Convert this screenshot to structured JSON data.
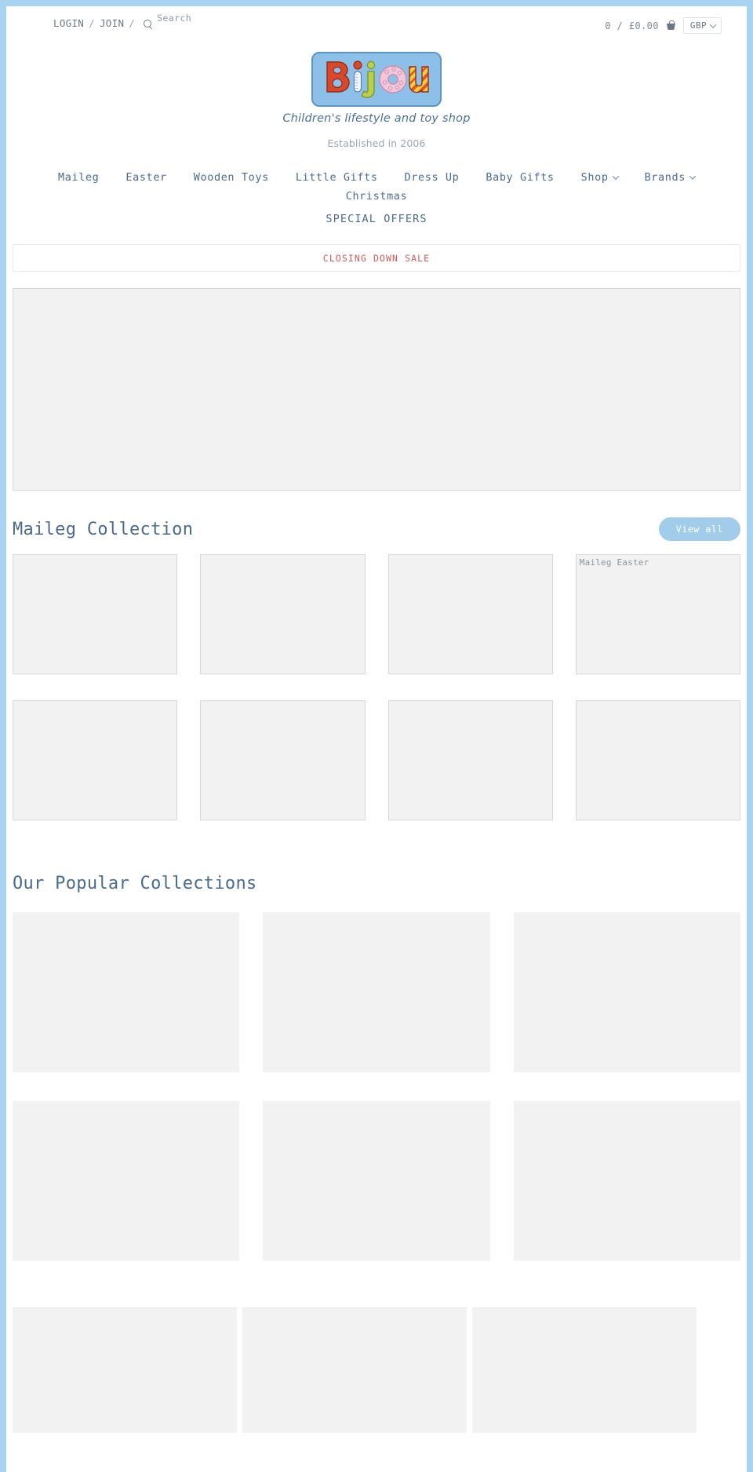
{
  "utility": {
    "login_label": "LOGIN",
    "join_label": "JOIN",
    "sep1": "/",
    "sep2": "/",
    "sep3": "/",
    "search_icon": "search-icon",
    "search_placeholder": "Search",
    "cart_summary": "0 / £0.00",
    "basket_icon": "basket-icon",
    "currency_value": "GBP",
    "currency_caret": "chevron-down-icon"
  },
  "brand": {
    "logo_text": "Bijou",
    "logo_letters": [
      "B",
      "i",
      "j",
      "o",
      "u"
    ],
    "tagline": "Children's lifestyle and toy shop",
    "established": "Established in 2006",
    "colors": {
      "logo_background": "#8cc0e8",
      "logo_border": "#5e93c4",
      "letter_b": "#d9482b",
      "letter_i_dot": "#d9482b",
      "letter_i_body": "#f4f7fb",
      "letter_j": "#b9d14a",
      "letter_o_donut": "#f2c7d8",
      "letter_u": "#e0562c",
      "tagline_text": "#4a6f9a"
    }
  },
  "nav": {
    "primary": [
      {
        "label": "Maileg",
        "has_dropdown": false
      },
      {
        "label": "Easter",
        "has_dropdown": false
      },
      {
        "label": "Wooden Toys",
        "has_dropdown": false
      },
      {
        "label": "Little Gifts",
        "has_dropdown": false
      },
      {
        "label": "Dress Up",
        "has_dropdown": false
      },
      {
        "label": "Baby Gifts",
        "has_dropdown": false
      },
      {
        "label": "Shop",
        "has_dropdown": true
      },
      {
        "label": "Brands",
        "has_dropdown": true
      },
      {
        "label": "Christmas",
        "has_dropdown": false
      }
    ],
    "secondary": {
      "label": "SPECIAL OFFERS"
    }
  },
  "banner": {
    "closing_down_sale": "CLOSING DOWN SALE",
    "color": "#cf5a5a"
  },
  "hero": {
    "name": "hero-banner-image"
  },
  "maileg_section": {
    "title": "Maileg Collection",
    "view_all_label": "View all",
    "view_all_color": "#a2cdea",
    "row1": [
      {
        "alt": ""
      },
      {
        "alt": ""
      },
      {
        "alt": ""
      },
      {
        "alt": "Maileg Easter"
      }
    ],
    "row2": [
      {
        "alt": ""
      },
      {
        "alt": ""
      },
      {
        "alt": ""
      },
      {
        "alt": ""
      }
    ]
  },
  "popular_section": {
    "title": "Our Popular Collections",
    "row1": [
      {
        "alt": ""
      },
      {
        "alt": ""
      },
      {
        "alt": ""
      }
    ],
    "row2": [
      {
        "alt": ""
      },
      {
        "alt": ""
      },
      {
        "alt": ""
      }
    ]
  },
  "bottom_band": {
    "tiles": [
      {
        "alt": ""
      },
      {
        "alt": ""
      },
      {
        "alt": ""
      }
    ]
  }
}
